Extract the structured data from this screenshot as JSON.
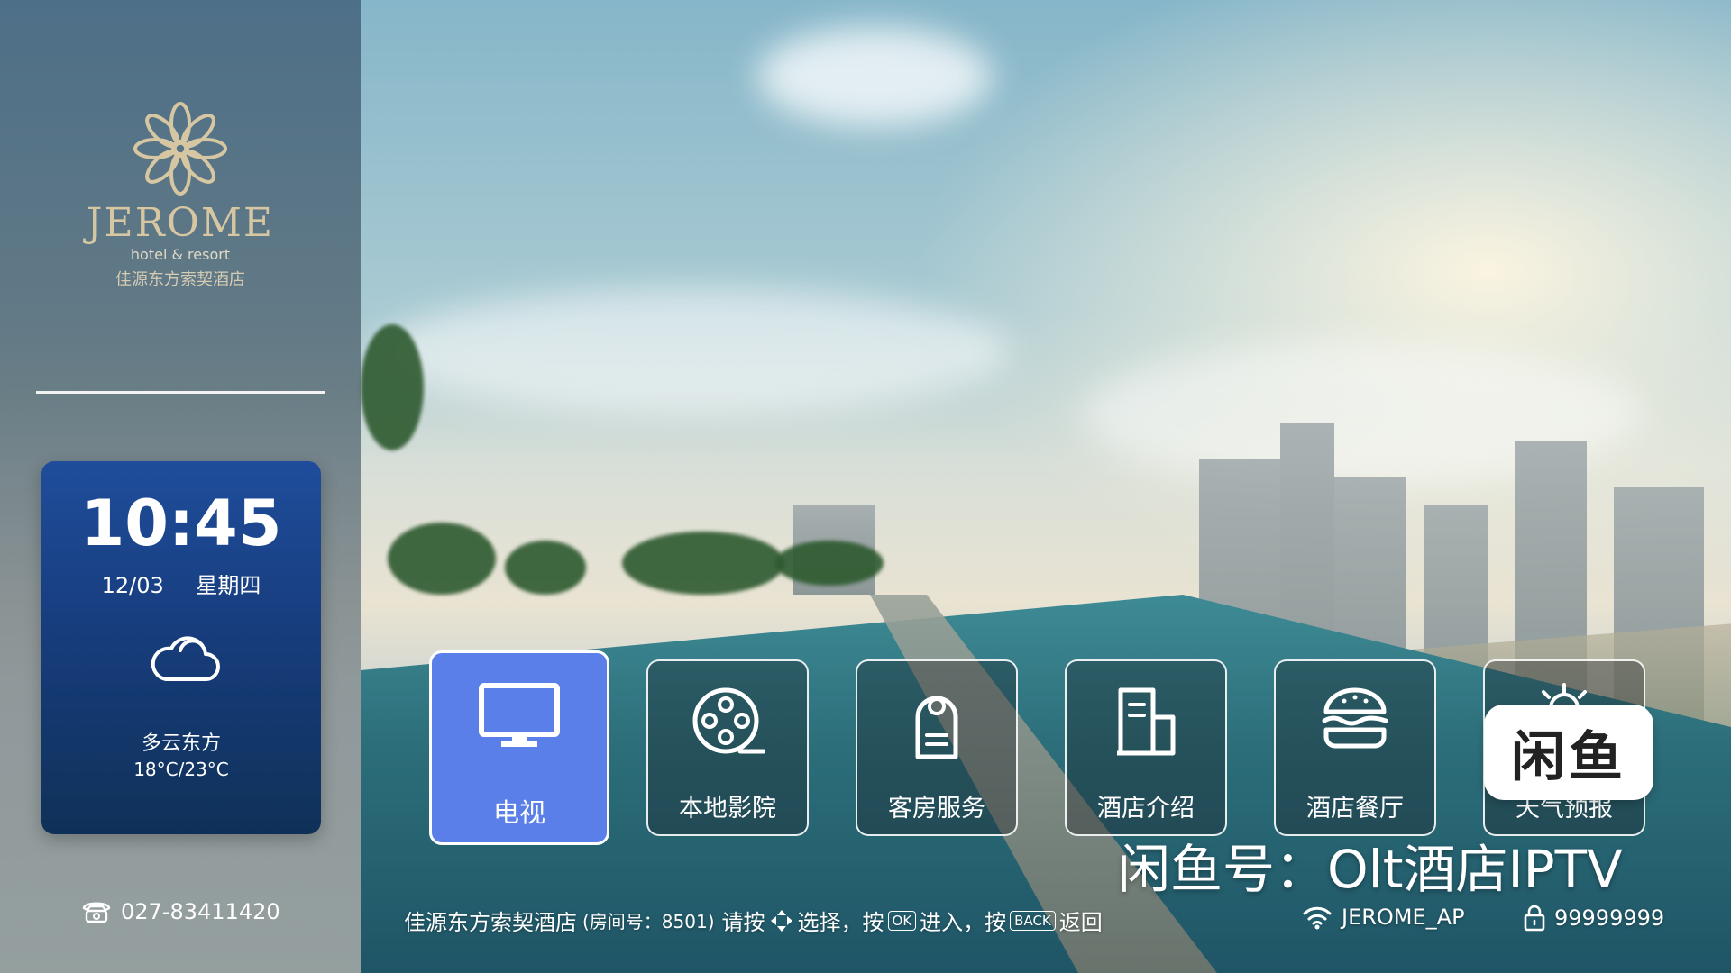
{
  "brand": {
    "name": "JEROME",
    "tagline": "hotel & resort",
    "name_cn": "佳源东方索契酒店"
  },
  "clock": {
    "time": "10:45",
    "date": "12/03",
    "weekday": "星期四",
    "weather_icon": "cloud-icon",
    "weather": "多云东方",
    "temperature": "18°C/23°C"
  },
  "contact": {
    "phone": "027-83411420"
  },
  "menu": [
    {
      "label": "电视",
      "icon": "tv-icon",
      "active": true
    },
    {
      "label": "本地影院",
      "icon": "film-reel-icon",
      "active": false
    },
    {
      "label": "客房服务",
      "icon": "door-hanger-icon",
      "active": false
    },
    {
      "label": "酒店介绍",
      "icon": "document-icon",
      "active": false
    },
    {
      "label": "酒店餐厅",
      "icon": "burger-icon",
      "active": false
    },
    {
      "label": "天气预报",
      "icon": "weather-sun-icon",
      "active": false
    }
  ],
  "overlay": {
    "badge": "闲鱼",
    "watermark": "闲鱼号：Olt酒店IPTV"
  },
  "status_bar": {
    "hotel": "佳源东方索契酒店",
    "room": "(房间号：8501)",
    "hint_press": "请按",
    "hint_select": "选择，按",
    "ok_key": "OK",
    "hint_enter": "进入，按",
    "back_key": "BACK",
    "hint_back": "返回",
    "wifi_name": "JEROME_AP",
    "wifi_password": "99999999"
  },
  "colors": {
    "active_tile": "#5a7fe8",
    "clock_card": "#1f4d9b",
    "brand_gold": "#d6c7a2"
  }
}
